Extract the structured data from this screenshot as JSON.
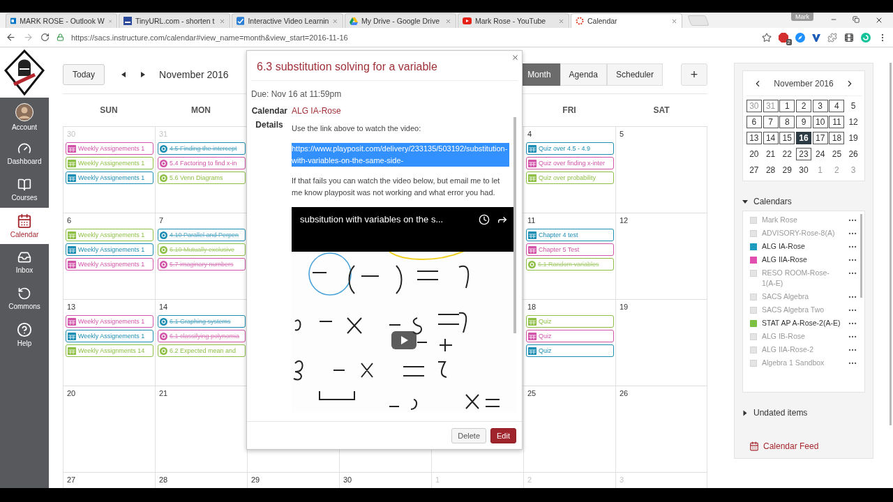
{
  "browser": {
    "tabs": [
      {
        "kind": "outlook",
        "title": "MARK ROSE - Outlook W",
        "selected": false
      },
      {
        "kind": "tinyurl",
        "title": "TinyURL.com - shorten t",
        "selected": false
      },
      {
        "kind": "playposit",
        "title": "Interactive Video Learnin",
        "selected": false
      },
      {
        "kind": "drive",
        "title": "My Drive - Google Drive",
        "selected": false
      },
      {
        "kind": "youtube",
        "title": "Mark Rose - YouTube",
        "selected": false
      },
      {
        "kind": "canvas",
        "title": "Calendar",
        "selected": true
      }
    ],
    "profile": "Mark",
    "url": "https://sacs.instructure.com/calendar#view_name=month&view_start=2016-11-16",
    "adblock_badge": "2"
  },
  "nav": {
    "items": [
      {
        "kind": "account",
        "label": "Account",
        "selected": false
      },
      {
        "kind": "dashboard",
        "label": "Dashboard",
        "selected": false
      },
      {
        "kind": "courses",
        "label": "Courses",
        "selected": false
      },
      {
        "kind": "calendar",
        "label": "Calendar",
        "selected": true
      },
      {
        "kind": "inbox",
        "label": "Inbox",
        "selected": false
      },
      {
        "kind": "commons",
        "label": "Commons",
        "selected": false
      },
      {
        "kind": "help",
        "label": "Help",
        "selected": false
      }
    ]
  },
  "toolbar": {
    "today": "Today",
    "month_title": "November 2016",
    "views": [
      {
        "label": "Month",
        "selected": true
      },
      {
        "label": "Agenda",
        "selected": false
      },
      {
        "label": "Scheduler",
        "selected": false
      }
    ],
    "add": "+"
  },
  "weekdays": {
    "sun": "SUN",
    "mon": "MON",
    "fri": "FRI",
    "sat": "SAT"
  },
  "weeks": [
    {
      "sun": {
        "day": "30",
        "outside": true,
        "events": [
          {
            "kind": "assignment",
            "color": "#d254a8",
            "title": "Weekly Assignements 1",
            "struck": false
          },
          {
            "kind": "assignment",
            "color": "#8dbf44",
            "title": "Weekly Assignements 1",
            "struck": false
          },
          {
            "kind": "assignment",
            "color": "#1c8db3",
            "title": "Weekly Assignements 1",
            "struck": false
          }
        ]
      },
      "mon": {
        "day": "31",
        "outside": true,
        "events": [
          {
            "kind": "quiz",
            "color": "#1c8db3",
            "title": "4.5 Finding the intercept",
            "struck": true
          },
          {
            "kind": "quiz",
            "color": "#d254a8",
            "title": "5.4 Factoring to find x-in",
            "struck": false
          },
          {
            "kind": "quiz",
            "color": "#8dbf44",
            "title": "5.6 Venn Diagrams",
            "struck": false
          }
        ]
      },
      "fri": {
        "day": "4",
        "outside": false,
        "events": [
          {
            "kind": "assignment",
            "color": "#1c8db3",
            "title": "Quiz over 4.5 - 4.9",
            "struck": false
          },
          {
            "kind": "assignment",
            "color": "#d254a8",
            "title": "Quiz over finding x-inter",
            "struck": false
          },
          {
            "kind": "assignment",
            "color": "#8dbf44",
            "title": "Quiz over probability",
            "struck": false
          }
        ]
      },
      "sat": {
        "day": "5",
        "outside": false
      }
    },
    {
      "sun": {
        "day": "6",
        "outside": false,
        "events": [
          {
            "kind": "assignment",
            "color": "#8dbf44",
            "title": "Weekly Assignements 1",
            "struck": false
          },
          {
            "kind": "assignment",
            "color": "#1c8db3",
            "title": "Weekly Assignements 1",
            "struck": false
          },
          {
            "kind": "assignment",
            "color": "#d254a8",
            "title": "Weekly Assignements 1",
            "struck": false
          }
        ]
      },
      "mon": {
        "day": "7",
        "outside": false,
        "events": [
          {
            "kind": "quiz",
            "color": "#1c8db3",
            "title": "4.10 Parallel and Perpen",
            "struck": true
          },
          {
            "kind": "quiz",
            "color": "#8dbf44",
            "title": "6.10 Mutually exclusive",
            "struck": true
          },
          {
            "kind": "quiz",
            "color": "#d254a8",
            "title": "5.7 imaginary numbers",
            "struck": true
          }
        ]
      },
      "fri": {
        "day": "11",
        "outside": false,
        "events": [
          {
            "kind": "assignment",
            "color": "#1c8db3",
            "title": "Chapter 4 test",
            "struck": false
          },
          {
            "kind": "assignment",
            "color": "#d254a8",
            "title": "Chapter 5 Test",
            "struck": false
          },
          {
            "kind": "quiz",
            "color": "#8dbf44",
            "title": "6.1 Random variables",
            "struck": true
          }
        ]
      },
      "sat": {
        "day": "12",
        "outside": false
      }
    },
    {
      "sun": {
        "day": "13",
        "outside": false,
        "events": [
          {
            "kind": "assignment",
            "color": "#d254a8",
            "title": "Weekly Assignements 1",
            "struck": false
          },
          {
            "kind": "assignment",
            "color": "#1c8db3",
            "title": "Weekly Assignements 1",
            "struck": false
          },
          {
            "kind": "assignment",
            "color": "#8dbf44",
            "title": "Weekly Assignments 14",
            "struck": false
          }
        ]
      },
      "mon": {
        "day": "14",
        "outside": false,
        "events": [
          {
            "kind": "quiz",
            "color": "#1c8db3",
            "title": "6.1 Graphing systems",
            "struck": true
          },
          {
            "kind": "quiz",
            "color": "#d254a8",
            "title": "6.1 classifying polynomia",
            "struck": true
          },
          {
            "kind": "quiz",
            "color": "#8dbf44",
            "title": "6.2 Expected mean and",
            "struck": false
          }
        ]
      },
      "fri": {
        "day": "18",
        "outside": false,
        "events": [
          {
            "kind": "assignment",
            "color": "#8dbf44",
            "title": "Quiz",
            "struck": false
          },
          {
            "kind": "assignment",
            "color": "#d254a8",
            "title": "Quiz",
            "struck": false
          },
          {
            "kind": "assignment",
            "color": "#1c8db3",
            "title": "Quiz",
            "struck": false
          }
        ]
      },
      "sat": {
        "day": "19",
        "outside": false
      }
    },
    {
      "sun": {
        "day": "20",
        "outside": false
      },
      "mon": {
        "day": "21",
        "outside": false
      },
      "fri": {
        "day": "25",
        "outside": false
      },
      "sat": {
        "day": "26",
        "outside": false
      }
    },
    {
      "sun": {
        "day": "27",
        "outside": false
      },
      "mon": {
        "day": "28",
        "outside": false
      },
      "tue": {
        "day": "29",
        "outside": false
      },
      "wed": {
        "day": "30",
        "outside": false
      },
      "thu": {
        "day": "1",
        "outside": true
      },
      "fri": {
        "day": "2",
        "outside": true
      },
      "sat": {
        "day": "3",
        "outside": true
      }
    }
  ],
  "popup": {
    "title": "6.3 substitution solving for a variable",
    "due": "Due: Nov 16 at 11:59pm",
    "calendar_label": "Calendar",
    "calendar": "ALG IA-Rose",
    "details_label": "Details",
    "intro": "Use the link above to watch the video:",
    "link": {
      "text": "https://www.playposit.com/delivery/233135/503192/substitution-with-variables-on-the-same-side-",
      "highlighted": true
    },
    "note": "If that fails you can watch the video below, but email me to let me know playposit was not working and what error you had.",
    "video": {
      "title": "subsitution with variables on the s...",
      "kind": "picture"
    },
    "buttons": [
      {
        "kind": "delete",
        "label": "Delete"
      },
      {
        "kind": "edit",
        "label": "Edit"
      }
    ]
  },
  "sidebar": {
    "mini_calendar": {
      "title": "November 2016",
      "weeks": [
        [
          {
            "day": "30",
            "outside": true,
            "has_events": true,
            "selected": false
          },
          {
            "day": "31",
            "outside": true,
            "has_events": true,
            "selected": false
          },
          {
            "day": "1",
            "outside": false,
            "has_events": true,
            "selected": false
          },
          {
            "day": "2",
            "outside": false,
            "has_events": true,
            "selected": false
          },
          {
            "day": "3",
            "outside": false,
            "has_events": true,
            "selected": false
          },
          {
            "day": "4",
            "outside": false,
            "has_events": true,
            "selected": false
          },
          {
            "day": "5",
            "outside": false,
            "has_events": false,
            "selected": false
          }
        ],
        [
          {
            "day": "6",
            "outside": false,
            "has_events": true,
            "selected": false
          },
          {
            "day": "7",
            "outside": false,
            "has_events": true,
            "selected": false
          },
          {
            "day": "8",
            "outside": false,
            "has_events": true,
            "selected": false
          },
          {
            "day": "9",
            "outside": false,
            "has_events": true,
            "selected": false
          },
          {
            "day": "10",
            "outside": false,
            "has_events": true,
            "selected": false
          },
          {
            "day": "11",
            "outside": false,
            "has_events": true,
            "selected": false
          },
          {
            "day": "12",
            "outside": false,
            "has_events": false,
            "selected": false
          }
        ],
        [
          {
            "day": "13",
            "outside": false,
            "has_events": true,
            "selected": false
          },
          {
            "day": "14",
            "outside": false,
            "has_events": true,
            "selected": false
          },
          {
            "day": "15",
            "outside": false,
            "has_events": true,
            "selected": false
          },
          {
            "day": "16",
            "outside": false,
            "has_events": true,
            "selected": true
          },
          {
            "day": "17",
            "outside": false,
            "has_events": true,
            "selected": false
          },
          {
            "day": "18",
            "outside": false,
            "has_events": true,
            "selected": false
          },
          {
            "day": "19",
            "outside": false,
            "has_events": false,
            "selected": false
          }
        ],
        [
          {
            "day": "20",
            "outside": false,
            "has_events": false,
            "selected": false
          },
          {
            "day": "21",
            "outside": false,
            "has_events": false,
            "selected": false
          },
          {
            "day": "22",
            "outside": false,
            "has_events": false,
            "selected": false
          },
          {
            "day": "23",
            "outside": false,
            "has_events": true,
            "selected": false
          },
          {
            "day": "24",
            "outside": false,
            "has_events": false,
            "selected": false
          },
          {
            "day": "25",
            "outside": false,
            "has_events": false,
            "selected": false
          },
          {
            "day": "26",
            "outside": false,
            "has_events": false,
            "selected": false
          }
        ],
        [
          {
            "day": "27",
            "outside": false,
            "has_events": false,
            "selected": false
          },
          {
            "day": "28",
            "outside": false,
            "has_events": false,
            "selected": false
          },
          {
            "day": "29",
            "outside": false,
            "has_events": false,
            "selected": false
          },
          {
            "day": "30",
            "outside": false,
            "has_events": false,
            "selected": false
          },
          {
            "day": "1",
            "outside": true,
            "has_events": false,
            "selected": false
          },
          {
            "day": "2",
            "outside": true,
            "has_events": false,
            "selected": false
          },
          {
            "day": "3",
            "outside": true,
            "has_events": false,
            "selected": false
          }
        ]
      ]
    },
    "calendars_heading": {
      "label": "Calendars",
      "expanded": true
    },
    "calendars": [
      {
        "name": "Mark Rose",
        "checked": false
      },
      {
        "name": "ADVISORY-Rose-8(A)",
        "checked": false
      },
      {
        "name": "ALG IA-Rose",
        "checked": true,
        "color": "#1c9bbf"
      },
      {
        "name": "ALG IIA-Rose",
        "checked": true,
        "color": "#e04fb0"
      },
      {
        "name": "RESO ROOM-Rose-1(A-E)",
        "checked": false
      },
      {
        "name": "SACS Algebra",
        "checked": false
      },
      {
        "name": "SACS Algebra Two",
        "checked": false
      },
      {
        "name": "STAT AP A-Rose-2(A-E)",
        "checked": true,
        "color": "#7dc142"
      },
      {
        "name": "ALG IB-Rose",
        "checked": false
      },
      {
        "name": "ALG IIA-Rose-2",
        "checked": false
      },
      {
        "name": "Algebra 1 Sandbox",
        "checked": false
      }
    ],
    "undated": {
      "label": "Undated items",
      "expanded": false
    },
    "feed": "Calendar Feed"
  }
}
